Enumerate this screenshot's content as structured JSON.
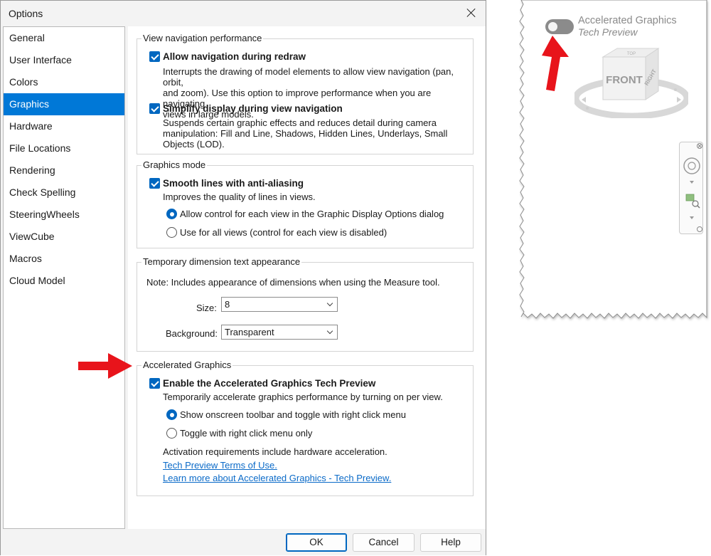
{
  "dialog": {
    "title": "Options",
    "nav_items": [
      "General",
      "User Interface",
      "Colors",
      "Graphics",
      "Hardware",
      "File Locations",
      "Rendering",
      "Check Spelling",
      "SteeringWheels",
      "ViewCube",
      "Macros",
      "Cloud Model"
    ],
    "selected_nav": "Graphics",
    "view_nav": {
      "title": "View navigation performance",
      "allow_label": "Allow navigation during redraw",
      "allow_desc_1": "Interrupts the drawing of model elements to allow view navigation (pan, orbit,",
      "allow_desc_2": "and zoom). Use this option to improve performance when you are navigating",
      "allow_desc_3": "views in large models.",
      "simplify_label": "Simplify display during view navigation",
      "simplify_desc_1": "Suspends certain graphic effects and reduces detail during camera",
      "simplify_desc_2": "manipulation: Fill and Line, Shadows, Hidden Lines, Underlays, Small",
      "simplify_desc_3": "Objects (LOD)."
    },
    "graphics_mode": {
      "title": "Graphics mode",
      "smooth_label": "Smooth lines with anti-aliasing",
      "smooth_desc": "Improves the quality of lines in views.",
      "radio_1": "Allow control for each view in the Graphic Display Options dialog",
      "radio_2": "Use for all views (control for each view is disabled)"
    },
    "temp_dim": {
      "title": "Temporary dimension text appearance",
      "note": "Note: Includes appearance of dimensions when using the Measure tool.",
      "size_label": "Size:",
      "size_value": "8",
      "bg_label": "Background:",
      "bg_value": "Transparent"
    },
    "accel": {
      "title": "Accelerated Graphics",
      "enable_label": "Enable the Accelerated Graphics Tech Preview",
      "enable_desc": "Temporarily accelerate graphics performance by turning on per view.",
      "radio_1": "Show onscreen toolbar and toggle with right click menu",
      "radio_2": "Toggle with right click menu only",
      "requirements": "Activation requirements include hardware acceleration.",
      "link_terms": "Tech Preview Terms of Use.",
      "link_learn": "Learn more about Accelerated Graphics - Tech Preview."
    },
    "buttons": {
      "ok": "OK",
      "cancel": "Cancel",
      "help": "Help"
    }
  },
  "preview": {
    "label": "Accelerated Graphics",
    "sublabel": "Tech Preview",
    "viewcube_front": "FRONT",
    "viewcube_right": "RIGHT",
    "viewcube_top": "TOP"
  },
  "colors": {
    "accent": "#0078d7",
    "arrow": "#e8141b",
    "link": "#0a6ac8"
  }
}
